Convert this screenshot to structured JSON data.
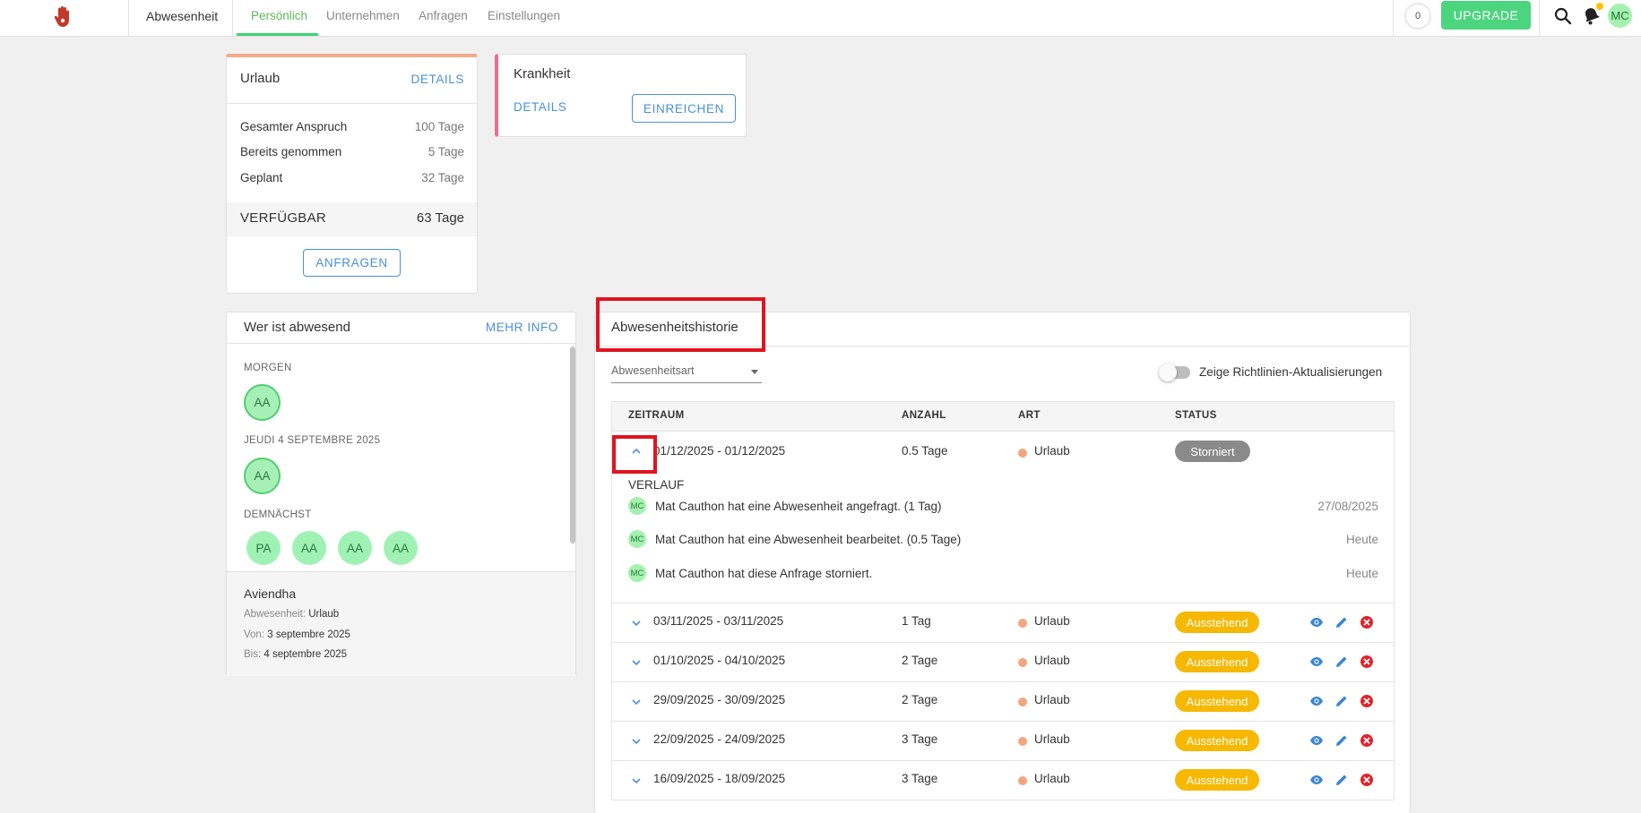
{
  "topbar": {
    "brand": "Abwesenheit",
    "tabs": [
      "Persönlich",
      "Unternehmen",
      "Anfragen",
      "Einstellungen"
    ],
    "active_tab": "Persönlich",
    "notification_count": "0",
    "upgrade_label": "UPGRADE",
    "user_initials": "MC",
    "colors": {
      "accent": "#3dd672",
      "upgrade": "#4cd57f",
      "notify_dot": "#ffc107"
    }
  },
  "urlaub": {
    "title": "Urlaub",
    "details_link": "DETAILS",
    "rows": [
      {
        "label": "Gesamter Anspruch",
        "value": "100 Tage"
      },
      {
        "label": "Bereits genommen",
        "value": "5 Tage"
      },
      {
        "label": "Geplant",
        "value": "32 Tage"
      }
    ],
    "available_label": "VERFÜGBAR",
    "available_value": "63 Tage",
    "request_button": "ANFRAGEN"
  },
  "krankheit": {
    "title": "Krankheit",
    "details_link": "DETAILS",
    "submit_button": "EINREICHEN"
  },
  "absent": {
    "title": "Wer ist abwesend",
    "more_link": "MEHR INFO",
    "sections": [
      {
        "label": "MORGEN",
        "people": [
          "AA"
        ]
      },
      {
        "label": "JEUDI 4 SEPTEMBRE 2025",
        "people": [
          "AA"
        ]
      },
      {
        "label": "DEMNÄCHST",
        "people": [
          "PA",
          "AA",
          "AA",
          "AA"
        ]
      }
    ],
    "detail": {
      "name": "Aviendha",
      "type_label": "Abwesenheit:",
      "type_value": "Urlaub",
      "from_label": "Von:",
      "from_value": "3 septembre 2025",
      "to_label": "Bis:",
      "to_value": "4 septembre 2025"
    }
  },
  "history": {
    "title": "Abwesenheitshistorie",
    "filter_placeholder": "Abwesenheitsart",
    "toggle_label": "Zeige Richtlinien-Aktualisierungen",
    "columns": [
      "ZEITRAUM",
      "ANZAHL",
      "ART",
      "STATUS"
    ],
    "expanded": {
      "period": "01/12/2025 - 01/12/2025",
      "amount": "0.5 Tage",
      "type": "Urlaub",
      "status": "Storniert",
      "log_title": "VERLAUF",
      "log": [
        {
          "initials": "MC",
          "text": "Mat Cauthon hat eine Abwesenheit angefragt. (1 Tag)",
          "date": "27/08/2025"
        },
        {
          "initials": "MC",
          "text": "Mat Cauthon hat eine Abwesenheit bearbeitet. (0.5 Tage)",
          "date": "Heute"
        },
        {
          "initials": "MC",
          "text": "Mat Cauthon hat diese Anfrage storniert.",
          "date": "Heute"
        }
      ]
    },
    "rows": [
      {
        "period": "03/11/2025 - 03/11/2025",
        "amount": "1 Tag",
        "type": "Urlaub",
        "status": "Ausstehend"
      },
      {
        "period": "01/10/2025 - 04/10/2025",
        "amount": "2 Tage",
        "type": "Urlaub",
        "status": "Ausstehend"
      },
      {
        "period": "29/09/2025 - 30/09/2025",
        "amount": "2 Tage",
        "type": "Urlaub",
        "status": "Ausstehend"
      },
      {
        "period": "22/09/2025 - 24/09/2025",
        "amount": "3 Tage",
        "type": "Urlaub",
        "status": "Ausstehend"
      },
      {
        "period": "16/09/2025 - 18/09/2025",
        "amount": "3 Tage",
        "type": "Urlaub",
        "status": "Ausstehend"
      }
    ],
    "colors": {
      "cancelled": "#8a8a8a",
      "pending": "#f6b800",
      "type_dot": "#f4a57f",
      "highlight": "#e0141e"
    }
  }
}
